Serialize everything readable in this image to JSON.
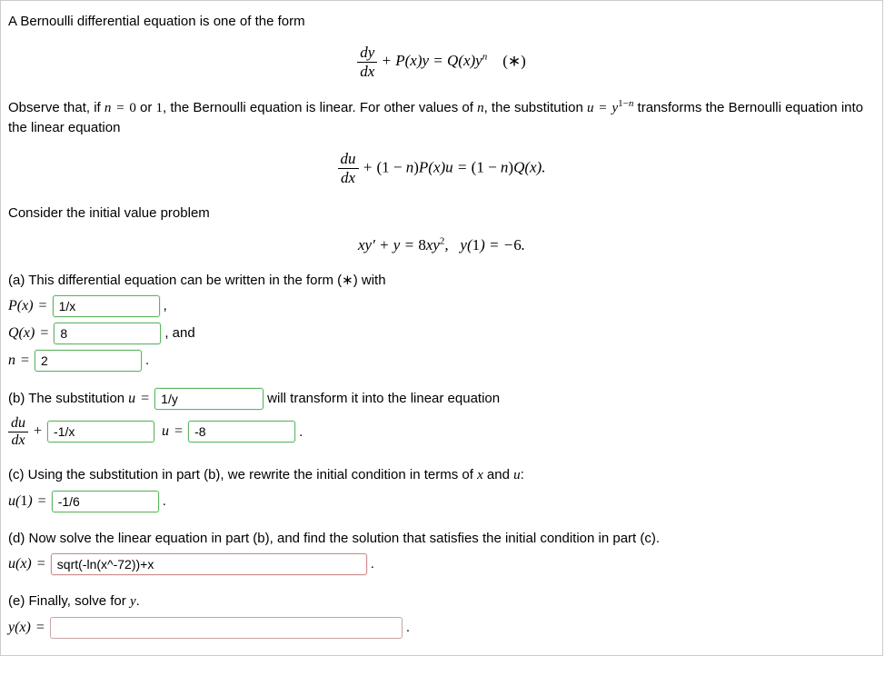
{
  "intro": {
    "line1": "A Bernoulli differential equation is one of the form",
    "observe_pre": "Observe that, if ",
    "observe_mid": " or ",
    "observe_post": ", the Bernoulli equation is linear. For other values of ",
    "observe_end": ", the substitution ",
    "observe_final": " transforms the Bernoulli equation into the linear equation",
    "consider": "Consider the initial value problem"
  },
  "eq_main_star": "(∗)",
  "parts": {
    "a": {
      "text": "(a) This differential equation can be written in the form (∗) with",
      "P_label": "P(x) = ",
      "P_value": "1/x",
      "Q_label": "Q(x) = ",
      "Q_value": "8",
      "and": ", and",
      "n_label": "n = ",
      "n_value": "2"
    },
    "b": {
      "pre": "(b) The substitution ",
      "u_eq": "u = ",
      "u_value": "1/y",
      "post": " will transform it into the linear equation",
      "coeff_value": "-1/x",
      "u_eq2": "u = ",
      "rhs_value": "-8"
    },
    "c": {
      "text": "(c) Using the substitution in part (b), we rewrite the initial condition in terms of ",
      "and": " and ",
      "colon": ":",
      "u1_label": "u(1) = ",
      "u1_value": "-1/6"
    },
    "d": {
      "text": "(d) Now solve the linear equation in part (b), and find the solution that satisfies the initial condition in part (c).",
      "ux_label": "u(x) = ",
      "ux_value": "sqrt(-ln(x^-72))+x"
    },
    "e": {
      "text": "(e) Finally, solve for ",
      "yx_label": "y(x) = ",
      "yx_value": ""
    }
  },
  "punct": {
    "comma": ",",
    "period": "."
  }
}
